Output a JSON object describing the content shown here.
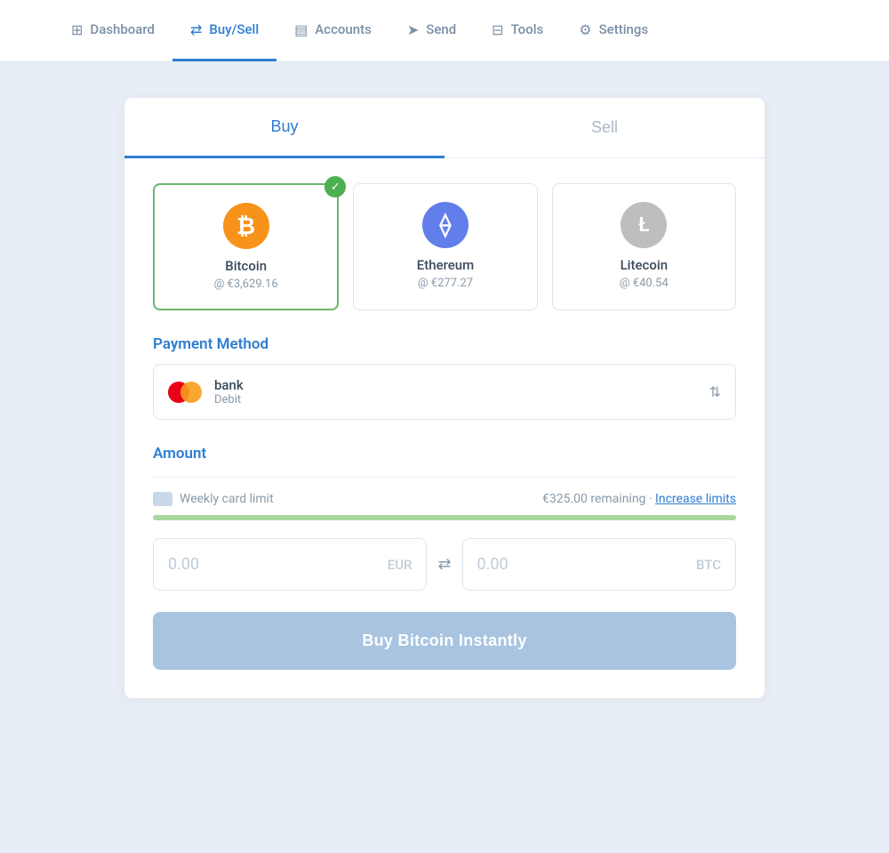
{
  "nav": {
    "items": [
      {
        "id": "dashboard",
        "label": "Dashboard",
        "icon": "⊞",
        "active": false
      },
      {
        "id": "buysell",
        "label": "Buy/Sell",
        "icon": "⇄",
        "active": true
      },
      {
        "id": "accounts",
        "label": "Accounts",
        "icon": "▤",
        "active": false
      },
      {
        "id": "send",
        "label": "Send",
        "icon": "➤",
        "active": false
      },
      {
        "id": "tools",
        "label": "Tools",
        "icon": "⊟",
        "active": false
      },
      {
        "id": "settings",
        "label": "Settings",
        "icon": "⚙",
        "active": false
      }
    ]
  },
  "tabs": {
    "buy_label": "Buy",
    "sell_label": "Sell"
  },
  "cryptos": [
    {
      "id": "bitcoin",
      "name": "Bitcoin",
      "price": "@ €3,629.16",
      "selected": true
    },
    {
      "id": "ethereum",
      "name": "Ethereum",
      "price": "@ €277.27",
      "selected": false
    },
    {
      "id": "litecoin",
      "name": "Litecoin",
      "price": "@ €40.54",
      "selected": false
    }
  ],
  "payment": {
    "section_label": "Payment Method",
    "name": "bank",
    "type": "Debit"
  },
  "amount": {
    "section_label": "Amount",
    "limit_label": "Weekly card limit",
    "remaining": "€325.00 remaining",
    "dot_separator": "·",
    "increase_label": "Increase limits",
    "eur_value": "0.00",
    "eur_currency": "EUR",
    "btc_value": "0.00",
    "btc_currency": "BTC",
    "progress_pct": 100
  },
  "buy_button": {
    "label": "Buy Bitcoin Instantly"
  }
}
